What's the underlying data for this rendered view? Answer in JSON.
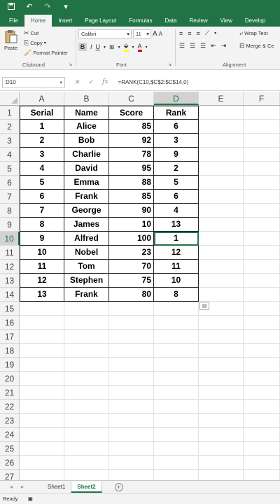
{
  "titlebar": {
    "icons": [
      "save-icon",
      "undo-icon",
      "redo-icon",
      "customize-icon"
    ]
  },
  "tabs": [
    "File",
    "Home",
    "Insert",
    "Page Layout",
    "Formulas",
    "Data",
    "Review",
    "View",
    "Develop"
  ],
  "ribbon": {
    "clipboard": {
      "paste": "Paste",
      "cut": "Cut",
      "copy": "Copy",
      "format_painter": "Format Painter",
      "label": "Clipboard"
    },
    "font": {
      "name": "Calibri",
      "size": "11",
      "bold": "B",
      "italic": "I",
      "underline": "U",
      "label": "Font",
      "grow": "A",
      "shrink": "A"
    },
    "alignment": {
      "wrap_text": "Wrap Text",
      "merge": "Merge & Ce",
      "label": "Alignment"
    }
  },
  "formula_bar": {
    "name_box": "D10",
    "formula": "=RANK(C10,$C$2:$C$14,0)"
  },
  "columns": [
    "A",
    "B",
    "C",
    "D",
    "E",
    "F"
  ],
  "selected_column": "D",
  "selected_row": 10,
  "rows": [
    [
      "Serial",
      "Name",
      "Score",
      "Rank"
    ],
    [
      "1",
      "Alice",
      "85",
      "6"
    ],
    [
      "2",
      "Bob",
      "92",
      "3"
    ],
    [
      "3",
      "Charlie",
      "78",
      "9"
    ],
    [
      "4",
      "David",
      "95",
      "2"
    ],
    [
      "5",
      "Emma",
      "88",
      "5"
    ],
    [
      "6",
      "Frank",
      "85",
      "6"
    ],
    [
      "7",
      "George",
      "90",
      "4"
    ],
    [
      "8",
      "James",
      "10",
      "13"
    ],
    [
      "9",
      "Alfred",
      "100",
      "1"
    ],
    [
      "10",
      "Nobel",
      "23",
      "12"
    ],
    [
      "11",
      "Tom",
      "70",
      "11"
    ],
    [
      "12",
      "Stephen",
      "75",
      "10"
    ],
    [
      "13",
      "Frank",
      "80",
      "8"
    ]
  ],
  "total_rows": 27,
  "sheets": [
    "Sheet1",
    "Sheet2"
  ],
  "active_sheet": "Sheet2",
  "status": "Ready"
}
